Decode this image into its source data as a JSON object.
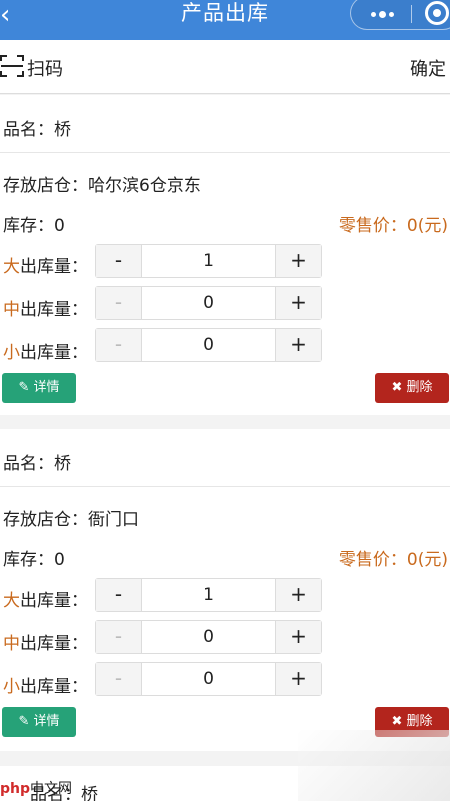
{
  "nav": {
    "title": "产品出库"
  },
  "scan": {
    "label": "扫码",
    "confirm": "确定"
  },
  "products": [
    {
      "name_label": "品名：",
      "name": "桥",
      "warehouse_label": "存放店仓：",
      "warehouse": "哈尔滨6仓京东",
      "stock_label": "库存：",
      "stock": "0",
      "price_label": "零售价：",
      "price": "0(元)",
      "qty": [
        {
          "prefix": "大",
          "label": "出库量：",
          "value": "1"
        },
        {
          "prefix": "中",
          "label": "出库量：",
          "value": "0"
        },
        {
          "prefix": "小",
          "label": "出库量：",
          "value": "0"
        }
      ],
      "detail_label": "详情",
      "delete_label": "删除"
    },
    {
      "name_label": "品名：",
      "name": "桥",
      "warehouse_label": "存放店仓：",
      "warehouse": "衙门口",
      "stock_label": "库存：",
      "stock": "0",
      "price_label": "零售价：",
      "price": "0(元)",
      "qty": [
        {
          "prefix": "大",
          "label": "出库量：",
          "value": "1"
        },
        {
          "prefix": "中",
          "label": "出库量：",
          "value": "0"
        },
        {
          "prefix": "小",
          "label": "出库量：",
          "value": "0"
        }
      ],
      "detail_label": "详情",
      "delete_label": "删除"
    }
  ],
  "stepper": {
    "minus": "-",
    "plus": "+"
  },
  "peek": {
    "text": "品名：桥"
  },
  "watermark": {
    "php": "php",
    "cn": "中文网"
  },
  "colors": {
    "nav": "#3f86d9",
    "accent": "#c96a1e",
    "detail": "#26a278",
    "delete": "#b3251d"
  }
}
